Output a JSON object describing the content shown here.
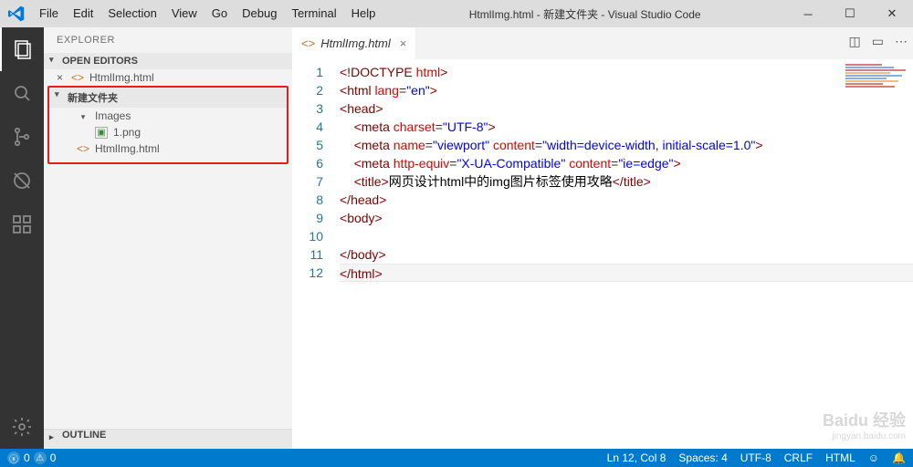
{
  "window": {
    "title": "HtmlImg.html - 新建文件夹 - Visual Studio Code"
  },
  "menu": [
    "File",
    "Edit",
    "Selection",
    "View",
    "Go",
    "Debug",
    "Terminal",
    "Help"
  ],
  "sidebar": {
    "header": "EXPLORER",
    "openEditors": {
      "label": "OPEN EDITORS",
      "items": [
        {
          "name": "HtmlImg.html",
          "dirty": false
        }
      ]
    },
    "folder": {
      "label": "新建文件夹",
      "children": [
        {
          "name": "Images",
          "type": "folder",
          "open": true,
          "children": [
            {
              "name": "1.png",
              "type": "image"
            }
          ]
        },
        {
          "name": "HtmlImg.html",
          "type": "html"
        }
      ]
    },
    "outline": {
      "label": "OUTLINE"
    }
  },
  "editor": {
    "tab": {
      "name": "HtmlImg.html"
    },
    "actions": [
      "split-editor",
      "toggle-layout",
      "more"
    ],
    "code": {
      "lines": [
        {
          "n": 1,
          "t": "doctype",
          "text": "<!DOCTYPE html>"
        },
        {
          "n": 2,
          "t": "open",
          "tag": "html",
          "attrs": [
            [
              "lang",
              "en"
            ]
          ]
        },
        {
          "n": 3,
          "t": "open",
          "tag": "head"
        },
        {
          "n": 4,
          "t": "selfclose",
          "indent": 1,
          "tag": "meta",
          "attrs": [
            [
              "charset",
              "UTF-8"
            ]
          ]
        },
        {
          "n": 5,
          "t": "selfclose",
          "indent": 1,
          "tag": "meta",
          "attrs": [
            [
              "name",
              "viewport"
            ],
            [
              "content",
              "width=device-width, initial-scale=1.0"
            ]
          ]
        },
        {
          "n": 6,
          "t": "selfclose",
          "indent": 1,
          "tag": "meta",
          "attrs": [
            [
              "http-equiv",
              "X-UA-Compatible"
            ],
            [
              "content",
              "ie=edge"
            ]
          ]
        },
        {
          "n": 7,
          "t": "textwrap",
          "indent": 1,
          "tag": "title",
          "text": "网页设计html中的img图片标签使用攻略"
        },
        {
          "n": 8,
          "t": "close",
          "tag": "head"
        },
        {
          "n": 9,
          "t": "open",
          "tag": "body"
        },
        {
          "n": 10,
          "t": "blank"
        },
        {
          "n": 11,
          "t": "close",
          "tag": "body"
        },
        {
          "n": 12,
          "t": "close",
          "tag": "html",
          "cursor": true,
          "hl": true
        }
      ]
    }
  },
  "status": {
    "errors": "0",
    "warnings": "0",
    "cursor": "Ln 12, Col 8",
    "spaces": "Spaces: 4",
    "encoding": "UTF-8",
    "eol": "CRLF",
    "lang": "HTML",
    "feedback": "☺",
    "bell": "🔔"
  },
  "watermark": {
    "brand": "Baidu 经验",
    "url": "jingyan.baidu.com"
  },
  "colors": {
    "accent": "#007acc"
  }
}
